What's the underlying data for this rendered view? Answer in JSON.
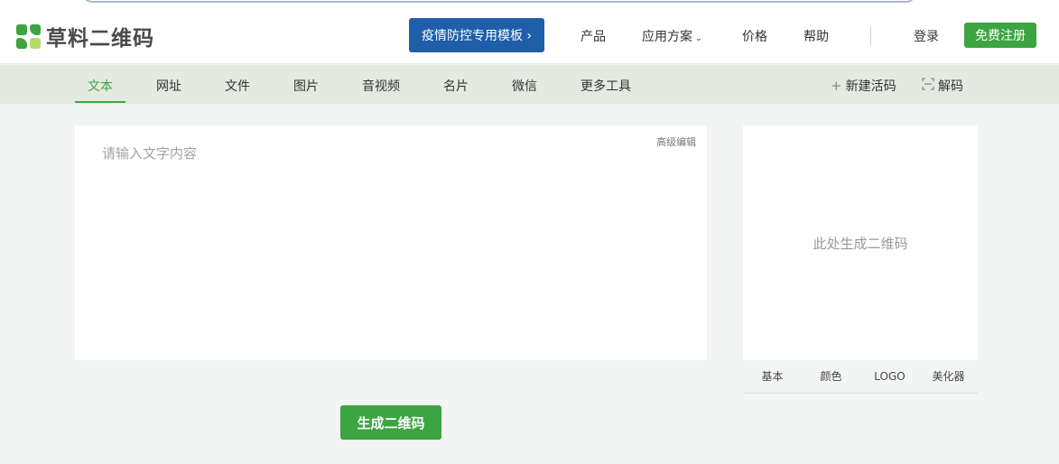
{
  "header": {
    "logo_text": "草料二维码",
    "promo_label": "疫情防控专用模板 ›",
    "nav": [
      {
        "label": "产品"
      },
      {
        "label": "应用方案"
      },
      {
        "label": "价格"
      },
      {
        "label": "帮助"
      }
    ],
    "login_label": "登录",
    "signup_label": "免费注册"
  },
  "tabs": {
    "items": [
      {
        "label": "文本",
        "active": true
      },
      {
        "label": "网址"
      },
      {
        "label": "文件"
      },
      {
        "label": "图片"
      },
      {
        "label": "音视频"
      },
      {
        "label": "名片"
      },
      {
        "label": "微信"
      },
      {
        "label": "更多工具"
      }
    ],
    "new_active_code": "新建活码",
    "decode": "解码"
  },
  "editor": {
    "placeholder": "请输入文字内容",
    "value": "",
    "advanced_label": "高级编辑"
  },
  "generate_button": "生成二维码",
  "qr_panel": {
    "placeholder": "此处生成二维码",
    "tabs": [
      "基本",
      "颜色",
      "LOGO",
      "美化器"
    ]
  },
  "colors": {
    "brand_green": "#3ca441",
    "promo_blue": "#1f5faa",
    "tabbar_bg": "#e5eae0",
    "page_bg": "#f3f4f4"
  }
}
